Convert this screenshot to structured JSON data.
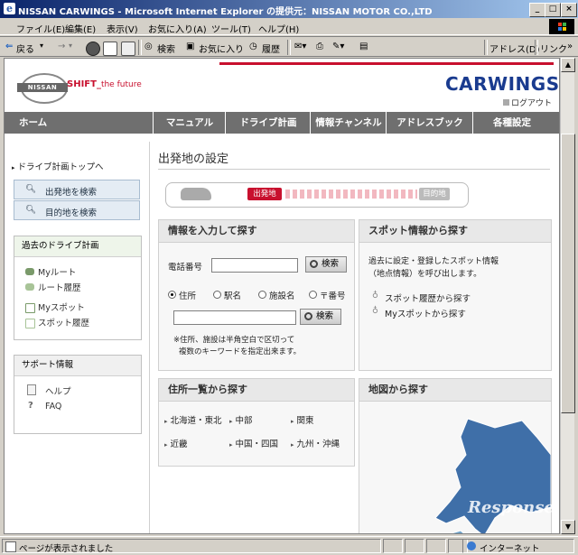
{
  "window": {
    "title": "NISSAN CARWINGS - Microsoft Internet Explorer の提供元：NISSAN MOTOR CO.,LTD",
    "min_label": "_",
    "max_label": "□",
    "close_label": "×"
  },
  "menubar": {
    "items": [
      "ファイル(E)",
      "編集(E)",
      "表示(V)",
      "お気に入り(A)",
      "ツール(T)",
      "ヘルプ(H)"
    ]
  },
  "toolbar": {
    "back_label": "戻る",
    "search_label": "検索",
    "favorites_label": "お気に入り",
    "history_label": "履歴",
    "address_label": "アドレス(D)",
    "links_label": "リンク",
    "forward_arrow": "→",
    "dropdown_arrow": "▾",
    "scroll_right": "»"
  },
  "site": {
    "logo_text": "NISSAN",
    "tagline_main": "SHIFT_",
    "tagline_sub": "the future",
    "brand": "CARWINGS",
    "registered": "®",
    "logout": "ログアウト"
  },
  "nav": {
    "items": [
      "ホーム",
      "マニュアル",
      "ドライブ計画",
      "情報チャンネル",
      "アドレスブック",
      "各種設定"
    ]
  },
  "sidebar": {
    "top_link": "ドライブ計画トップへ",
    "search_buttons": [
      "出発地を検索",
      "目的地を検索"
    ],
    "past_plans": {
      "title": "過去のドライブ計画",
      "items": [
        "Myルート",
        "ルート履歴",
        "Myスポット",
        "スポット履歴"
      ]
    },
    "support": {
      "title": "サポート情報",
      "items": [
        "ヘルプ",
        "FAQ"
      ]
    }
  },
  "main": {
    "page_title": "出発地の設定",
    "progress": {
      "start": "出発地",
      "end": "目的地"
    },
    "input_search": {
      "title": "情報を入力して探す",
      "phone_label": "電話番号",
      "search_button": "検索",
      "radios": [
        "住所",
        "駅名",
        "施設名",
        "〒番号"
      ],
      "selected_radio": "住所",
      "note_line1": "※住所、施設は半角空白で区切って",
      "note_line2": "複数のキーワードを指定出来ます。"
    },
    "spot_search": {
      "title": "スポット情報から探す",
      "desc_line1": "過去に設定・登録したスポット情報",
      "desc_line2": "（地点情報）を呼び出します。",
      "links": [
        "スポット履歴から探す",
        "Myスポットから探す"
      ]
    },
    "address_list": {
      "title": "住所一覧から探す",
      "regions": [
        "北海道・東北",
        "中部",
        "関東",
        "近畿",
        "中国・四国",
        "九州・沖縄"
      ]
    },
    "map_search": {
      "title": "地図から探す",
      "watermark": "Response."
    }
  },
  "statusbar": {
    "message": "ページが表示されました",
    "zone": "インターネット"
  },
  "colors": {
    "nissan_red": "#c8102e",
    "carwings_blue": "#1a3b8f",
    "map_blue": "#3f6fa8",
    "nav_gray": "#6f6f6f"
  }
}
